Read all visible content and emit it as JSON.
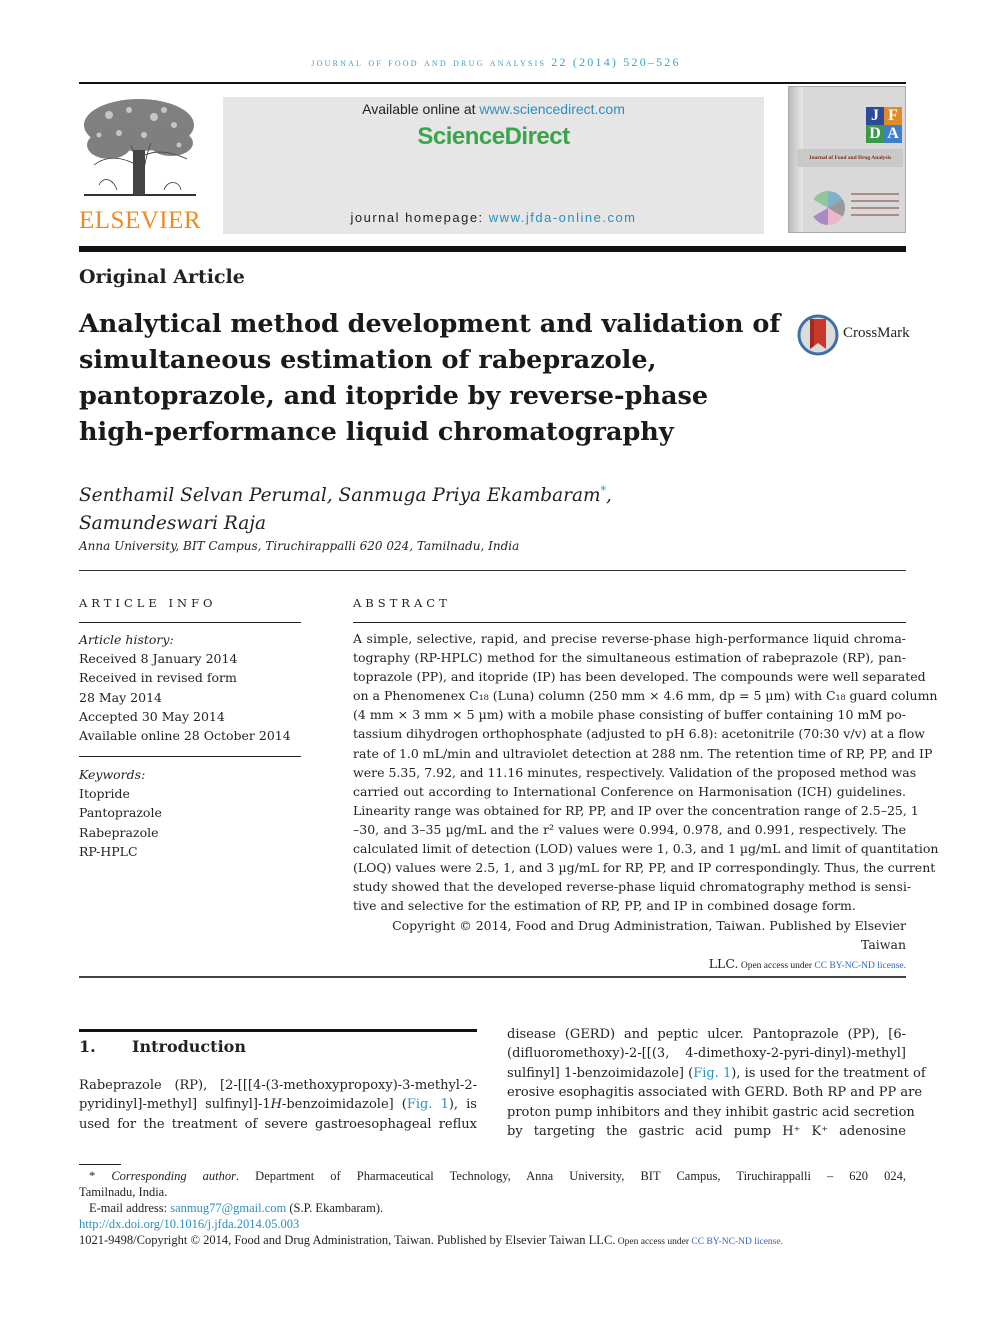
{
  "journal_header": {
    "running_head": "Journal of Food and Drug Analysis 22 (2014) 520–526",
    "publisher_logo_text": "ELSEVIER",
    "available_online_prefix": "Available online at ",
    "available_online_url": "www.sciencedirect.com",
    "platform_logo_text": "ScienceDirect",
    "homepage_prefix": "journal homepage: ",
    "homepage_url": "www.jfda-online.com",
    "cover": {
      "letters": [
        "J",
        "F",
        "D",
        "A"
      ],
      "letter_colors": [
        "#2b4a9a",
        "#e08a2a",
        "#3a9a4a",
        "#3f7ec8"
      ],
      "band_text": "Journal of Food and Drug Analysis"
    },
    "colors": {
      "running_head": "#3aa0c8",
      "elsevier_orange": "#f08a1e",
      "sciencedirect_green": "#3aa54a",
      "link_blue": "#2a8fbf"
    }
  },
  "article": {
    "type": "Original Article",
    "title_lines": [
      "Analytical method development and validation of",
      "simultaneous estimation of rabeprazole,",
      "pantoprazole, and itopride by reverse-phase",
      "high-performance liquid chromatography"
    ],
    "crossmark_label": "CrossMark",
    "authors_line1": "Senthamil Selvan Perumal, Sanmuga Priya Ekambaram",
    "corresponding_marker": "*",
    "authors_line1_suffix": ",",
    "authors_line2": "Samundeswari Raja",
    "affiliation": "Anna University, BIT Campus, Tiruchirappalli 620 024, Tamilnadu, India"
  },
  "article_info": {
    "label": "ARTICLE INFO",
    "history_label": "Article history:",
    "history": [
      "Received 8 January 2014",
      "Received in revised form",
      "28 May 2014",
      "Accepted 30 May 2014",
      "Available online 28 October 2014"
    ],
    "keywords_label": "Keywords:",
    "keywords": [
      "Itopride",
      "Pantoprazole",
      "Rabeprazole",
      "RP-HPLC"
    ]
  },
  "abstract": {
    "label": "ABSTRACT",
    "lines": [
      "A simple, selective, rapid, and precise reverse-phase high-performance liquid chroma-",
      "tography (RP-HPLC) method for the simultaneous estimation of rabeprazole (RP), pan-",
      "toprazole (PP), and itopride (IP) has been developed. The compounds were well separated",
      "on a Phenomenex C₁₈ (Luna) column (250 mm × 4.6 mm, dp = 5 µm) with C₁₈ guard column",
      "(4 mm × 3 mm × 5 µm) with a mobile phase consisting of buffer containing 10 mM po-",
      "tassium dihydrogen orthophosphate (adjusted to pH 6.8): acetonitrile (70:30 v/v) at a flow",
      "rate of 1.0 mL/min and ultraviolet detection at 288 nm. The retention time of RP, PP, and IP",
      "were 5.35, 7.92, and 11.16 minutes, respectively. Validation of the proposed method was",
      "carried out according to International Conference on Harmonisation (ICH) guidelines.",
      "Linearity range was obtained for RP, PP, and IP over the concentration range of 2.5–25, 1",
      "–30, and 3–35 µg/mL and the r² values were 0.994, 0.978, and 0.991, respectively. The",
      "calculated limit of detection (LOD) values were 1, 0.3, and 1 µg/mL and limit of quantitation",
      "(LOQ) values were 2.5, 1, and 3 µg/mL for RP, PP, and IP correspondingly. Thus, the current",
      "study showed that the developed reverse-phase liquid chromatography method is sensi-",
      "tive and selective for the estimation of RP, PP, and IP in combined dosage form."
    ],
    "copyright_line1": "Copyright © 2014, Food and Drug Administration, Taiwan. Published by Elsevier Taiwan",
    "copyright_line2": "LLC.",
    "open_access_prefix": " Open access under ",
    "license_link": "CC BY-NC-ND license."
  },
  "introduction": {
    "number": "1.",
    "heading": "Introduction",
    "left_lines": [
      "Rabeprazole (RP), [2-[[[4-(3-methoxypropoxy)-3-methyl-2-",
      "pyridinyl]-methyl] sulfinyl]-1H-benzoimidazole] (Fig. 1), is",
      "used for the treatment of severe gastroesophageal reflux"
    ],
    "fig_ref": "Fig. 1",
    "right_lines": [
      "disease (GERD) and peptic ulcer. Pantoprazole (PP), [6-",
      "(difluoromethoxy)-2-[[(3, 4-dimethoxy-2-pyri-dinyl)-methyl]",
      "sulfinyl] 1-benzoimidazole] (Fig. 1), is used for the treatment of",
      "erosive esophagitis associated with GERD. Both RP and PP are",
      "proton pump inhibitors and they inhibit gastric acid secretion",
      "by targeting the gastric acid pump H⁺ K⁺ adenosine"
    ]
  },
  "footnotes": {
    "corresponding_marker": "*",
    "corresponding_label": "Corresponding author",
    "corresponding_text": ". Department of Pharmaceutical Technology, Anna University, BIT Campus, Tiruchirappalli – 620 024,",
    "corresponding_text_cont": "Tamilnadu, India.",
    "email_label": "E-mail address: ",
    "email": "sanmug77@gmail.com",
    "email_owner": " (S.P. Ekambaram).",
    "doi": "http://dx.doi.org/10.1016/j.jfda.2014.05.003",
    "issn_copyright": "1021-9498/Copyright © 2014, Food and Drug Administration, Taiwan. Published by Elsevier Taiwan LLC.",
    "open_access_prefix": " Open access under ",
    "license_link": "CC BY-NC-ND license."
  }
}
